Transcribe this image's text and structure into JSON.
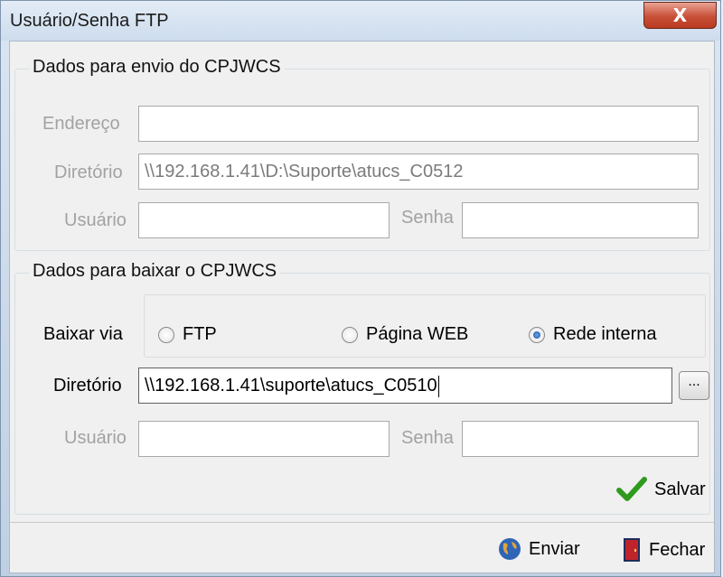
{
  "window": {
    "title": "Usuário/Senha FTP",
    "close_label": "X"
  },
  "send_group": {
    "legend": "Dados para envio do CPJWCS",
    "endereco_label": "Endereço",
    "endereco_value": "",
    "diretorio_label": "Diretório",
    "diretorio_value": "\\\\192.168.1.41\\D:\\Suporte\\atucs_C0512",
    "usuario_label": "Usuário",
    "usuario_value": "",
    "senha_label": "Senha",
    "senha_value": ""
  },
  "download_group": {
    "legend": "Dados para baixar o CPJWCS",
    "via_label": "Baixar via",
    "options": [
      {
        "label": "FTP",
        "selected": false
      },
      {
        "label": "Página WEB",
        "selected": false
      },
      {
        "label": "Rede interna",
        "selected": true
      }
    ],
    "diretorio_label": "Diretório",
    "diretorio_value": "\\\\192.168.1.41\\suporte\\atucs_C0510",
    "browse_label": "...",
    "usuario_label": "Usuário",
    "usuario_value": "",
    "senha_label": "Senha",
    "senha_value": ""
  },
  "buttons": {
    "salvar": "Salvar",
    "enviar": "Enviar",
    "fechar": "Fechar"
  },
  "colors": {
    "disabled_text": "#a2a2a2",
    "check_green": "#2e9a1e",
    "door_red": "#c0242a"
  }
}
